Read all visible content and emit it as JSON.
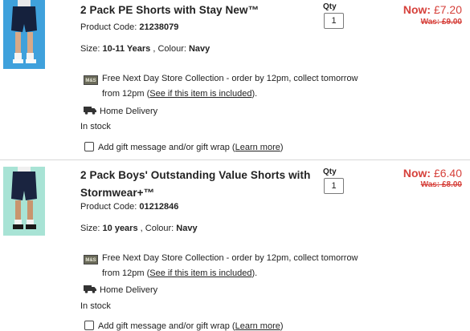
{
  "items": [
    {
      "title": "2 Pack PE Shorts with Stay New™",
      "product_code_label": "Product Code:",
      "product_code": "21238079",
      "size_label": "Size:",
      "size": "10-11 Years",
      "colour_label": ", Colour:",
      "colour": "Navy",
      "qty_label": "Qty",
      "qty_value": "1",
      "now_label": "Now:",
      "now_price": "£7.20",
      "was_price": "Was: £9.00",
      "store_collection_1": "Free Next Day Store Collection - order by 12pm, collect tomorrow",
      "store_collection_2": "from 12pm (",
      "see_included": "See if this item is included",
      "store_collection_3": ").",
      "home_delivery": "Home Delivery",
      "stock": "In stock",
      "gift_text": "Add gift message and/or gift wrap (",
      "learn_more": "Learn more",
      "gift_close": ")"
    },
    {
      "title": "2 Pack Boys' Outstanding Value Shorts with Stormwear+™",
      "product_code_label": "Product Code:",
      "product_code": "01212846",
      "size_label": "Size:",
      "size": "10 years",
      "colour_label": ", Colour:",
      "colour": "Navy",
      "qty_label": "Qty",
      "qty_value": "1",
      "now_label": "Now:",
      "now_price": "£6.40",
      "was_price": "Was: £8.00",
      "store_collection_1": "Free Next Day Store Collection - order by 12pm, collect tomorrow",
      "store_collection_2": "from 12pm (",
      "see_included": "See if this item is included",
      "store_collection_3": ").",
      "home_delivery": "Home Delivery",
      "stock": "In stock",
      "gift_text": "Add gift message and/or gift wrap (",
      "learn_more": "Learn more",
      "gift_close": ")"
    }
  ],
  "store_icon_text": "M&S",
  "colors": {
    "price": "#d6413b",
    "text": "#222222",
    "thumb1_bg": "#3fa1dc",
    "thumb2_bg": "#a8e3d5"
  }
}
